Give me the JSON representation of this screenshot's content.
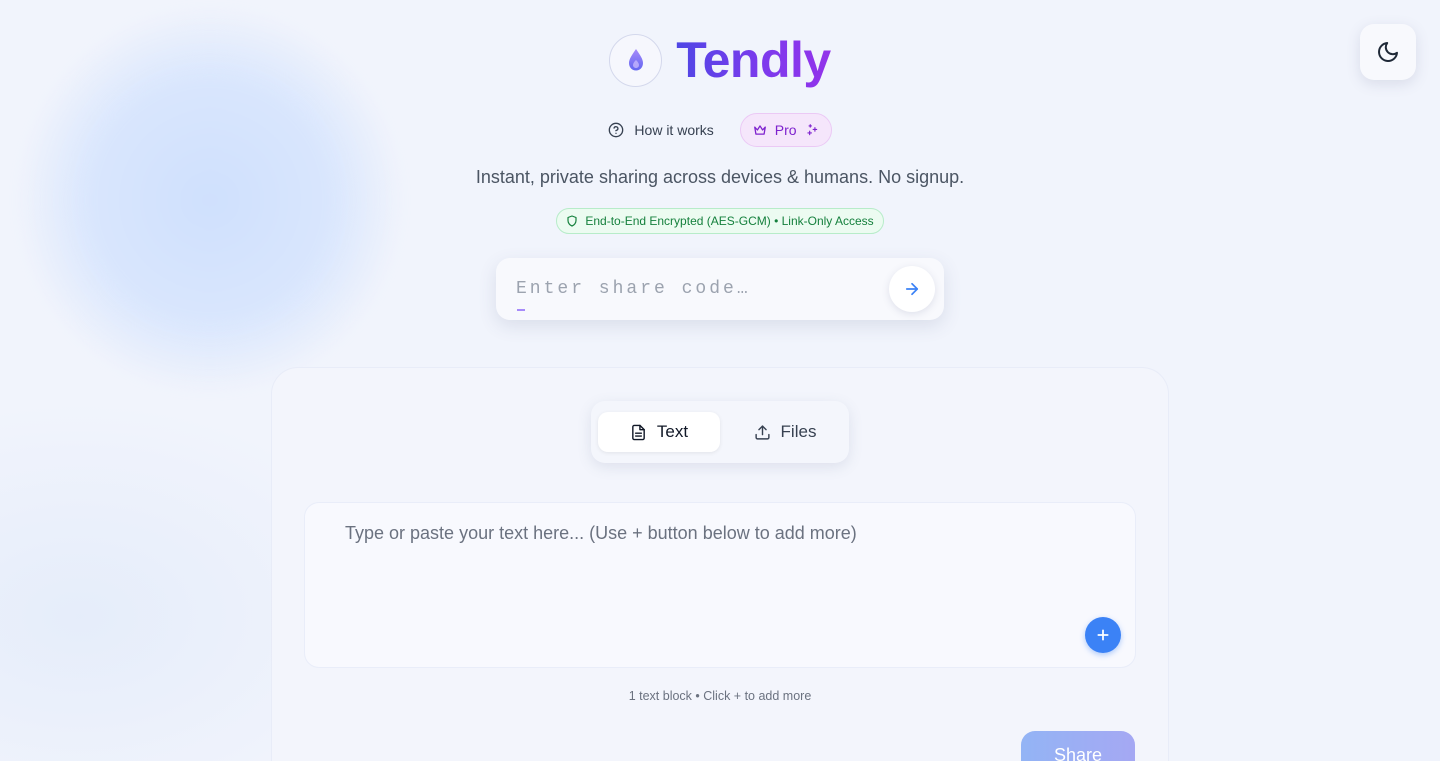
{
  "header": {
    "brand": "Tendly",
    "nav": {
      "how_it_works": "How it works",
      "pro": "Pro"
    },
    "tagline": "Instant, private sharing across devices & humans. No signup.",
    "security_badge": "End-to-End Encrypted (AES-GCM) • Link-Only Access"
  },
  "code_entry": {
    "placeholder": "Enter share code…",
    "value": ""
  },
  "share_card": {
    "tabs": [
      {
        "label": "Text",
        "icon": "file-text-icon",
        "active": true
      },
      {
        "label": "Files",
        "icon": "upload-icon",
        "active": false
      }
    ],
    "text_placeholder": "Type or paste your text here... (Use + button below to add more)",
    "add_label": "+",
    "hint": "1 text block • Click + to add more",
    "share_label": "Share"
  },
  "colors": {
    "accent_blue": "#3b82f6",
    "brand_indigo": "#4f46e5",
    "brand_purple": "#9333ea",
    "pro_purple": "#7e22ce",
    "secure_green": "#15803d"
  }
}
